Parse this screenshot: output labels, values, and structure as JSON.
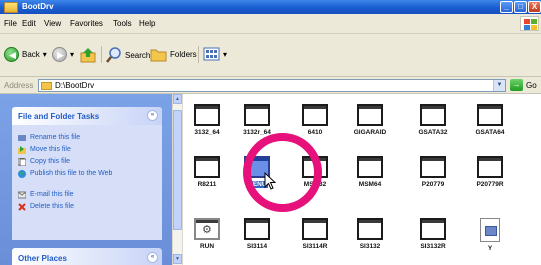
{
  "window": {
    "title": "BootDrv",
    "min_label": "_",
    "max_label": "□",
    "close_label": "X"
  },
  "menu": {
    "items": [
      "File",
      "Edit",
      "View",
      "Favorites",
      "Tools",
      "Help"
    ]
  },
  "toolbar": {
    "back_label": "Back",
    "search_label": "Search",
    "folders_label": "Folders",
    "dd_arrow": "▾"
  },
  "address": {
    "label": "Address",
    "path": "D:\\BootDrv",
    "go_label": "Go",
    "dropdown_arrow": "▼",
    "go_arrow": "→"
  },
  "tasks": {
    "title": "File and Folder Tasks",
    "chevron": "«",
    "items": [
      {
        "label": "Rename this file",
        "icon": "rename-icon"
      },
      {
        "label": "Move this file",
        "icon": "move-icon"
      },
      {
        "label": "Copy this file",
        "icon": "copy-icon"
      },
      {
        "label": "Publish this file to the Web",
        "icon": "publish-icon"
      },
      {
        "label": "E-mail this file",
        "icon": "email-icon"
      },
      {
        "label": "Delete this file",
        "icon": "delete-icon"
      }
    ]
  },
  "other_places": {
    "title": "Other Places",
    "chevron": "«"
  },
  "scroll": {
    "up": "▲",
    "down": "▼"
  },
  "files": [
    {
      "name": "3132_64"
    },
    {
      "name": "3132r_64"
    },
    {
      "name": "6410"
    },
    {
      "name": "GIGARAID"
    },
    {
      "name": "GSATA32"
    },
    {
      "name": "GSATA64"
    },
    {
      "name": "R8211"
    },
    {
      "name": "MENU",
      "selected": true
    },
    {
      "name": "MSM32"
    },
    {
      "name": "MSM64"
    },
    {
      "name": "P20779"
    },
    {
      "name": "P20779R"
    },
    {
      "name": "RUN",
      "icon": "run"
    },
    {
      "name": "SI3114"
    },
    {
      "name": "SI3114R"
    },
    {
      "name": "SI3132"
    },
    {
      "name": "SI3132R"
    },
    {
      "name": "Y",
      "icon": "config"
    }
  ],
  "colors": {
    "title_bar": "#1a5dd0",
    "highlight_ring": "#e6117a",
    "selection": "#3163c5",
    "task_link": "#215dc6"
  }
}
